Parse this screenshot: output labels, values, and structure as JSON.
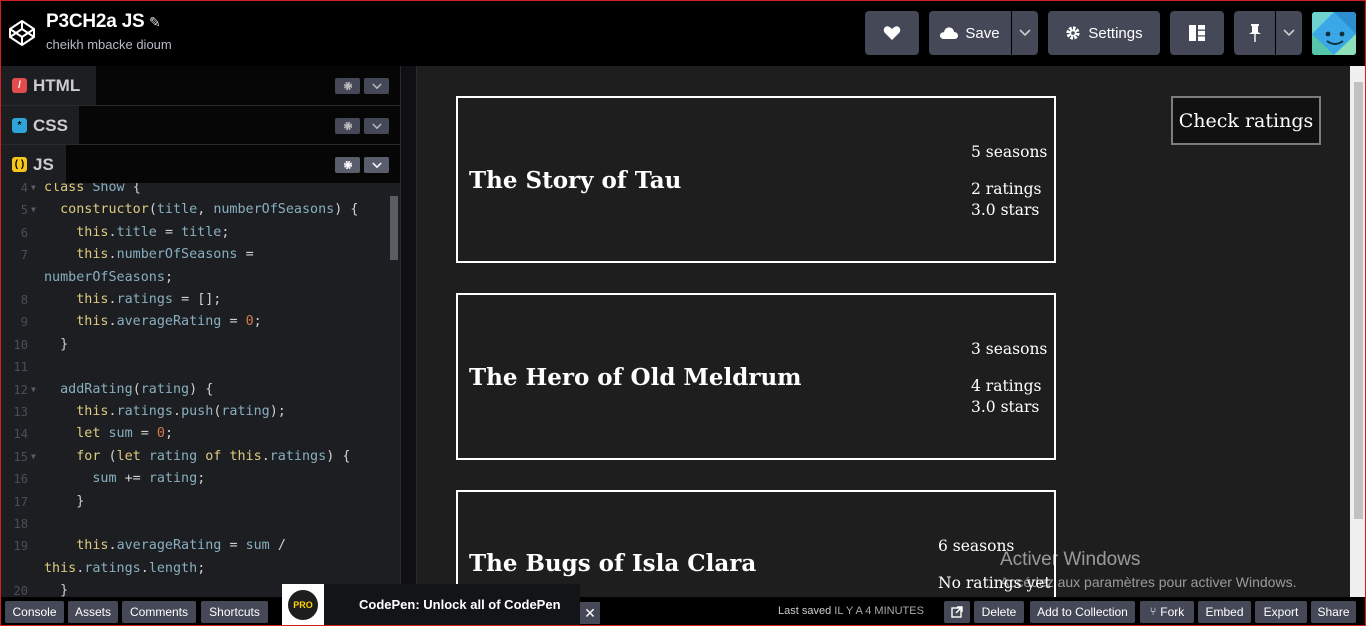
{
  "header": {
    "title": "P3CH2a JS",
    "author": "cheikh mbacke dioum",
    "save_label": "Save",
    "settings_label": "Settings"
  },
  "editor": {
    "tabs": [
      {
        "label": "HTML",
        "icon": "html-icon",
        "color": "#e34c4c"
      },
      {
        "label": "CSS",
        "icon": "css-icon",
        "color": "#2fa4d9"
      },
      {
        "label": "JS",
        "icon": "js-icon",
        "color": "#f7c61a"
      }
    ],
    "code_lines": [
      {
        "n": "4",
        "text": "class Show {"
      },
      {
        "n": "5",
        "text": "  constructor(title, numberOfSeasons) {"
      },
      {
        "n": "6",
        "text": "    this.title = title;"
      },
      {
        "n": "7",
        "text": "    this.numberOfSeasons ="
      },
      {
        "n": "",
        "text": "numberOfSeasons;"
      },
      {
        "n": "8",
        "text": "    this.ratings = [];"
      },
      {
        "n": "9",
        "text": "    this.averageRating = 0;"
      },
      {
        "n": "10",
        "text": "  }"
      },
      {
        "n": "11",
        "text": ""
      },
      {
        "n": "12",
        "text": "  addRating(rating) {"
      },
      {
        "n": "13",
        "text": "    this.ratings.push(rating);"
      },
      {
        "n": "14",
        "text": "    let sum = 0;"
      },
      {
        "n": "15",
        "text": "    for (let rating of this.ratings) {"
      },
      {
        "n": "16",
        "text": "      sum += rating;"
      },
      {
        "n": "17",
        "text": "    }"
      },
      {
        "n": "18",
        "text": ""
      },
      {
        "n": "19",
        "text": "    this.averageRating = sum /"
      },
      {
        "n": "",
        "text": "this.ratings.length;"
      },
      {
        "n": "20",
        "text": "  }"
      }
    ]
  },
  "result": {
    "shows": [
      {
        "title": "The Story of Tau",
        "seasons": "5 seasons",
        "ratings": "2 ratings",
        "stars": "3.0 stars"
      },
      {
        "title": "The Hero of Old Meldrum",
        "seasons": "3 seasons",
        "ratings": "4 ratings",
        "stars": "3.0 stars"
      },
      {
        "title": "The Bugs of Isla Clara",
        "seasons": "6 seasons",
        "ratings": "No ratings yet",
        "stars": ""
      }
    ],
    "check_button": "Check ratings"
  },
  "watermark": {
    "line1": "Activer Windows",
    "line2": "Accédez aux paramètres pour activer Windows."
  },
  "footer": {
    "console": "Console",
    "assets": "Assets",
    "comments": "Comments",
    "shortcuts": "Shortcuts",
    "promo_badge": "PRO",
    "promo_text": "CodePen: Unlock all of CodePen",
    "last_saved_prefix": "Last saved",
    "last_saved_time": "IL Y A 4 MINUTES",
    "delete": "Delete",
    "add_to_collection": "Add to Collection",
    "fork": "Fork",
    "embed": "Embed",
    "export": "Export",
    "share": "Share"
  }
}
